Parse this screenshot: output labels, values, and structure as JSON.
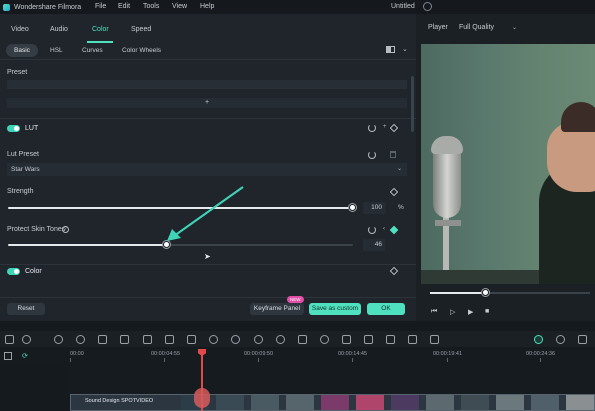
{
  "titlebar": {
    "app_name": "Wondershare Filmora",
    "menus": [
      "File",
      "Edit",
      "Tools",
      "View",
      "Help"
    ],
    "document_title": "Untitled"
  },
  "panel": {
    "tabs": [
      "Video",
      "Audio",
      "Color",
      "Speed"
    ],
    "active_tab": "Color",
    "subtabs": [
      "Basic",
      "HSL",
      "Curves",
      "Color Wheels"
    ],
    "active_subtab": "Basic",
    "preset_label": "Preset",
    "preset_add": "+",
    "lut": {
      "title": "LUT",
      "enabled": true,
      "preset_label": "Lut Preset",
      "preset_value": "Star Wars",
      "strength_label": "Strength",
      "strength_value": "100",
      "strength_unit": "%",
      "strength_fraction": 1.0,
      "protect_label": "Protect Skin Tones",
      "protect_help": "?",
      "protect_value": "46",
      "protect_fraction": 0.46
    },
    "color_section": {
      "title": "Color",
      "enabled": true
    },
    "buttons": {
      "reset": "Reset",
      "keyframe": "Keyframe Panel",
      "new_badge": "NEW",
      "save_custom": "Save as custom",
      "ok": "OK"
    }
  },
  "player": {
    "label": "Player",
    "quality": "Full Quality",
    "progress_fraction": 0.35
  },
  "timeline": {
    "ticks": [
      "00:00",
      "00:00:04:55",
      "00:00:09:50",
      "00:00:14:45",
      "00:00:19:41",
      "00:00:24:36"
    ],
    "clip_label": "Sound Design SPOTVIDEO"
  },
  "colors": {
    "accent": "#4fe0c0",
    "playhead": "#e24a4a",
    "badge": "#e24fa9"
  }
}
